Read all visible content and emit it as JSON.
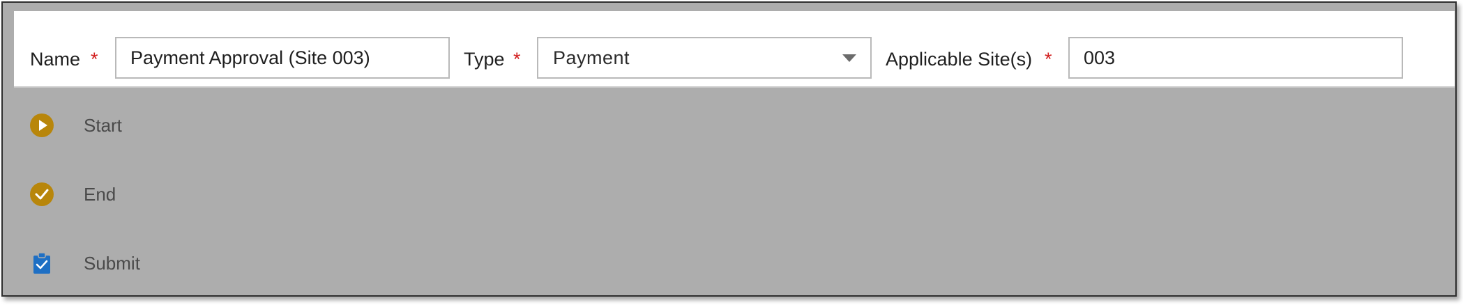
{
  "form": {
    "name": {
      "label": "Name",
      "required_mark": "*",
      "value": "Payment Approval (Site 003)"
    },
    "type": {
      "label": "Type",
      "required_mark": "*",
      "value": "Payment"
    },
    "sites": {
      "label": "Applicable Site(s)",
      "required_mark": "*",
      "value": "003"
    }
  },
  "palette": {
    "items": [
      {
        "label": "Start",
        "icon": "play-circle-icon"
      },
      {
        "label": "End",
        "icon": "check-circle-icon"
      },
      {
        "label": "Submit",
        "icon": "clipboard-check-icon"
      }
    ]
  },
  "colors": {
    "required": "#d21f1f",
    "start_end_icon": "#b8860b",
    "submit_icon": "#1e6fc4",
    "canvas_overlay": "#adadad"
  }
}
